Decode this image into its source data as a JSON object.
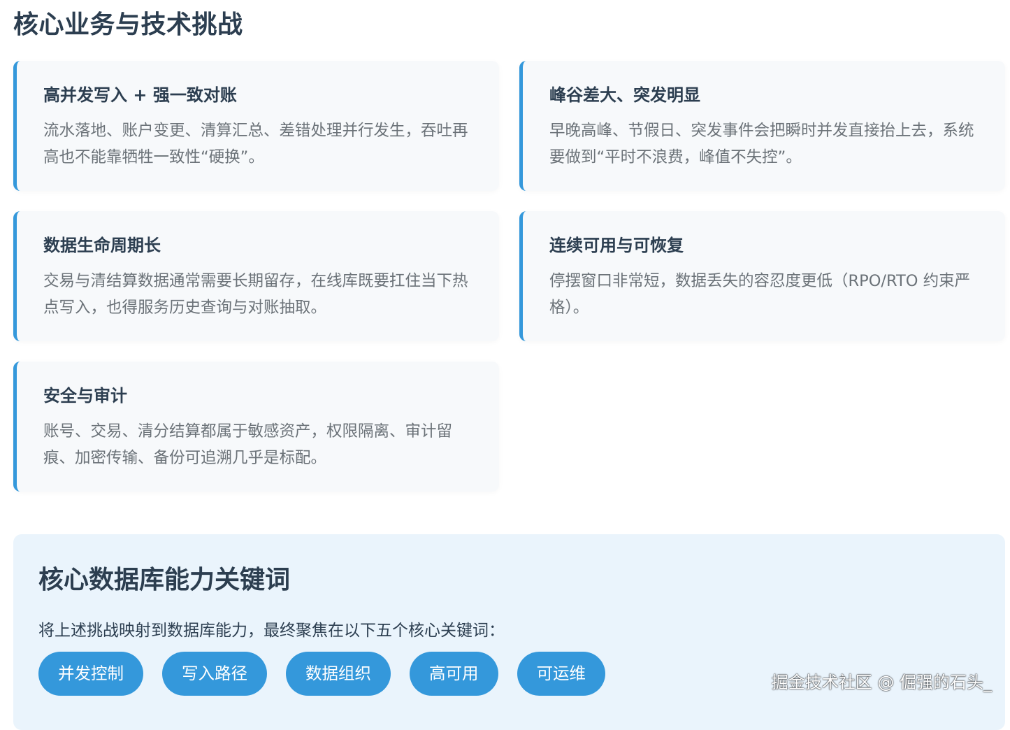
{
  "page": {
    "title": "核心业务与技术挑战"
  },
  "cards": [
    {
      "title": "高并发写入 + 强一致对账",
      "body": "流水落地、账户变更、清算汇总、差错处理并行发生，吞吐再高也不能靠牺牲一致性“硬换”。"
    },
    {
      "title": "峰谷差大、突发明显",
      "body": "早晚高峰、节假日、突发事件会把瞬时并发直接抬上去，系统要做到“平时不浪费，峰值不失控”。"
    },
    {
      "title": "数据生命周期长",
      "body": "交易与清结算数据通常需要长期留存，在线库既要扛住当下热点写入，也得服务历史查询与对账抽取。"
    },
    {
      "title": "连续可用与可恢复",
      "body": "停摆窗口非常短，数据丢失的容忍度更低（RPO/RTO 约束严格）。"
    },
    {
      "title": "安全与审计",
      "body": "账号、交易、清分结算都属于敏感资产，权限隔离、审计留痕、加密传输、备份可追溯几乎是标配。"
    }
  ],
  "keywords": {
    "title": "核心数据库能力关键词",
    "description": "将上述挑战映射到数据库能力，最终聚焦在以下五个核心关键词：",
    "tags": [
      "并发控制",
      "写入路径",
      "数据组织",
      "高可用",
      "可运维"
    ]
  },
  "watermark": "掘金技术社区 @ 倔强的石头_",
  "colors": {
    "accent": "#3498db",
    "card_bg": "#f7f9fb",
    "panel_bg": "#eaf4fc",
    "heading": "#2c3e50",
    "body_text": "#6b7278"
  }
}
